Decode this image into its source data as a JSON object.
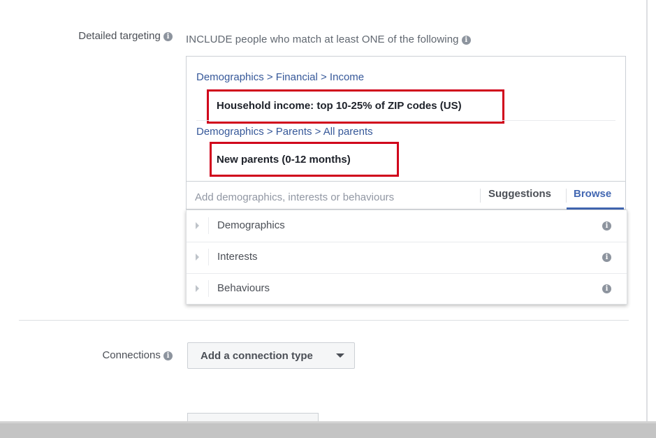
{
  "detailed_targeting": {
    "label": "Detailed targeting",
    "include_text": "INCLUDE people who match at least ONE of the following",
    "selections": [
      {
        "path": "Demographics > Financial > Income",
        "item": "Household income: top 10-25% of ZIP codes (US)"
      },
      {
        "path": "Demographics > Parents > All parents",
        "item": "New parents (0-12 months)"
      }
    ],
    "search_placeholder": "Add demographics, interests or behaviours",
    "suggestions_label": "Suggestions",
    "browse_label": "Browse",
    "categories": [
      {
        "label": "Demographics"
      },
      {
        "label": "Interests"
      },
      {
        "label": "Behaviours"
      }
    ]
  },
  "connections": {
    "label": "Connections",
    "button_label": "Add a connection type"
  },
  "icons": {
    "info": "info-icon",
    "caret": "caret-down-icon",
    "expand": "triangle-right-icon"
  },
  "colors": {
    "link": "#365899",
    "highlight": "#d0021b",
    "accent": "#4267b2"
  }
}
